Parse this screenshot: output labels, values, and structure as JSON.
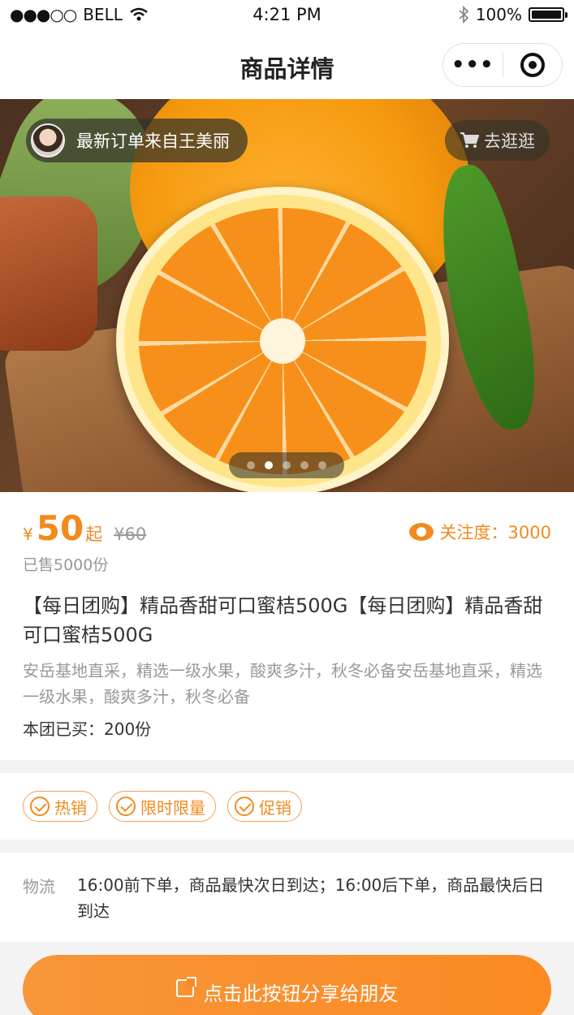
{
  "status_bar": {
    "carrier": "BELL",
    "signal": "●●●○○",
    "time": "4:21 PM",
    "battery": "100%",
    "battery_level": 1.0
  },
  "nav": {
    "title": "商品详情",
    "more_icon": "more-dots-icon",
    "close_icon": "target-icon"
  },
  "banner": {
    "latest_order": "最新订单来自王美丽",
    "shop_link": "去逛逛",
    "slides_total": 5,
    "active_slide": 2
  },
  "product": {
    "currency": "¥",
    "price": "50",
    "price_suffix": "起",
    "original_price": "¥60",
    "sold": "已售5000份",
    "focus_label": "关注度：3000",
    "title": "【每日团购】精品香甜可口蜜桔500G【每日团购】精品香甜可口蜜桔500G",
    "description": "安岳基地直采，精选一级水果，酸爽多汁，秋冬必备安岳基地直采，精选一级水果，酸爽多汁，秋冬必备",
    "group_bought": "本团已买：200份"
  },
  "tags": [
    "热销",
    "限时限量",
    "促销"
  ],
  "logistics": {
    "label": "物流",
    "text": "16:00前下单，商品最快次日到达；16:00后下单，商品最快后日到达"
  },
  "share_button": {
    "label": "点击此按钮分享给朋友"
  },
  "colors": {
    "accent": "#f28a1c",
    "button": "#fb8a22"
  }
}
